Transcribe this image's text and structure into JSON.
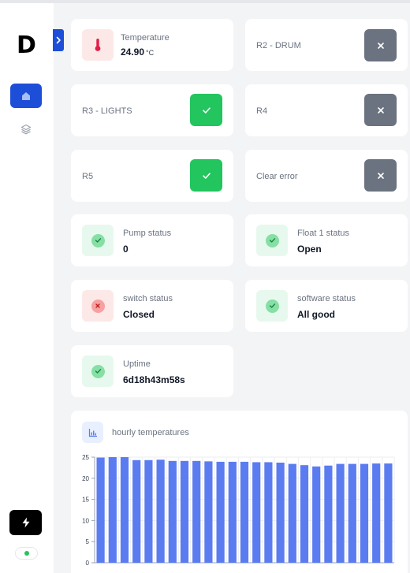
{
  "app": {
    "logo": "D"
  },
  "sidebar": {
    "nav": [
      {
        "name": "home",
        "active": true
      },
      {
        "name": "layers",
        "active": false
      }
    ],
    "connection_status_color": "#22c55e"
  },
  "colors": {
    "accent": "#1d4ed8",
    "on": "#22c55e",
    "off": "#6b7280",
    "bar": "#5b7cf0"
  },
  "temperature": {
    "label": "Temperature",
    "value": "24.90",
    "unit": "°C"
  },
  "relays": [
    {
      "label": "R2 - DRUM",
      "state": "off"
    },
    {
      "label": "R3 - LIGHTS",
      "state": "on"
    },
    {
      "label": "R4",
      "state": "off"
    },
    {
      "label": "R5",
      "state": "on"
    },
    {
      "label": "Clear error",
      "state": "off"
    }
  ],
  "statuses": [
    {
      "label": "Pump status",
      "value": "0",
      "ok": true
    },
    {
      "label": "Float 1 status",
      "value": "Open",
      "ok": true
    },
    {
      "label": "switch status",
      "value": "Closed",
      "ok": false
    },
    {
      "label": "software status",
      "value": "All good",
      "ok": true
    },
    {
      "label": "Uptime",
      "value": "6d18h43m58s",
      "ok": true
    }
  ],
  "chart": {
    "title": "hourly temperatures"
  },
  "chart_data": {
    "type": "bar",
    "title": "hourly temperatures",
    "xlabel": "",
    "ylabel": "",
    "ylim": [
      0,
      25
    ],
    "yticks": [
      0,
      5,
      10,
      15,
      20,
      25
    ],
    "grid": true,
    "values": [
      24.9,
      25.0,
      25.0,
      24.3,
      24.3,
      24.4,
      24.1,
      24.1,
      24.1,
      24.0,
      23.9,
      23.9,
      23.9,
      23.8,
      23.8,
      23.7,
      23.4,
      23.1,
      22.8,
      23.0,
      23.4,
      23.4,
      23.4,
      23.5,
      23.5
    ]
  }
}
